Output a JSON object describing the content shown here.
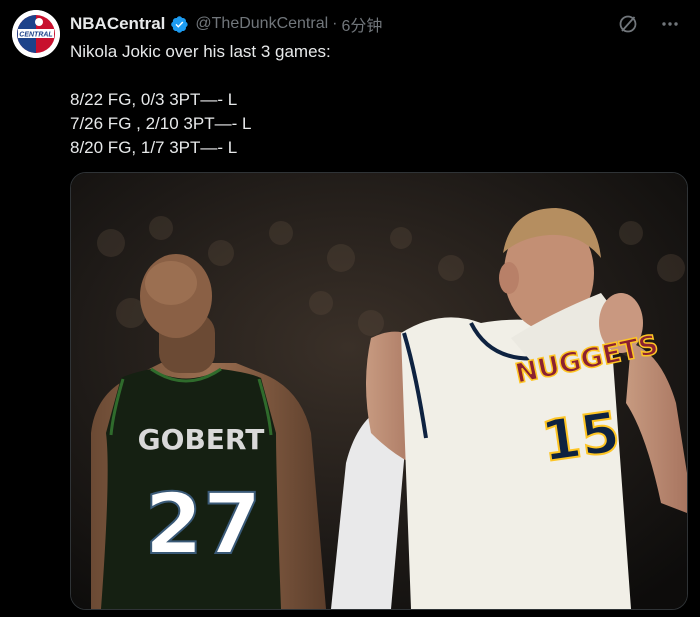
{
  "author": {
    "name": "NBACentral",
    "handle": "@TheDunkCentral",
    "separator": "·",
    "time": "6分钟",
    "avatar_text": "CENTRAL",
    "verified_icon": "verified-badge-icon",
    "verified_color": "#1d9bf0"
  },
  "tweet": {
    "lines": [
      "Nikola Jokic over his last 3 games:",
      "",
      "8/22 FG, 0/3 3PT—- L",
      "7/26 FG , 2/10 3PT—- L",
      "8/20 FG, 1/7 3PT—- L"
    ]
  },
  "header_icons": [
    "grok-icon",
    "more-icon"
  ],
  "media": {
    "left_jersey_name": "GOBERT",
    "left_jersey_number": "27",
    "right_jersey_team": "NUGGETS",
    "right_jersey_number": "15"
  },
  "colors": {
    "background": "#000000",
    "text": "#e7e9ea",
    "muted": "#71767b",
    "nuggets_red": "#8b2131",
    "nuggets_gold": "#fec524",
    "wolves_navy": "#0c2340"
  }
}
